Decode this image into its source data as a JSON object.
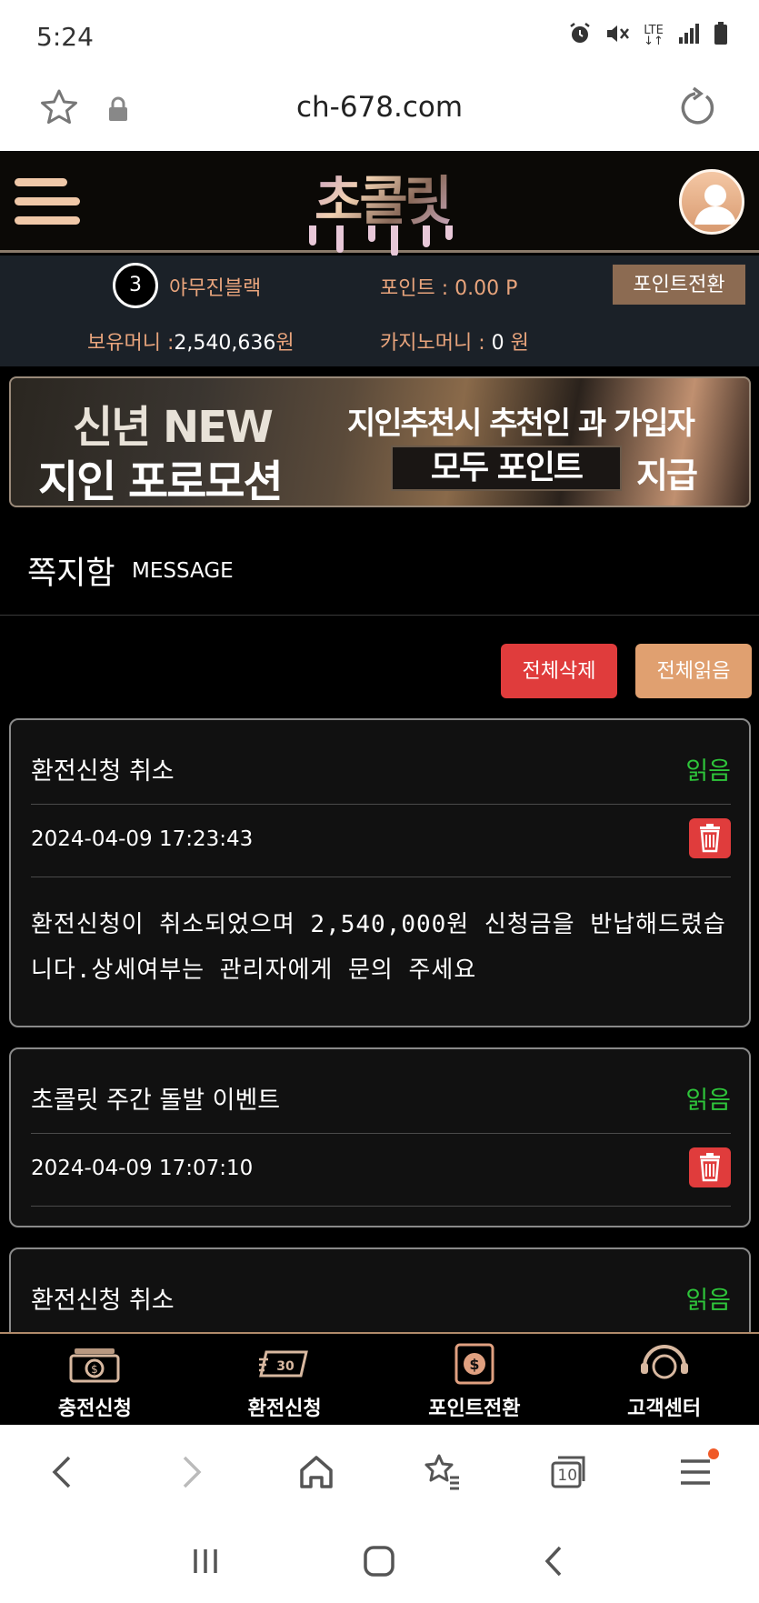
{
  "status_bar": {
    "time": "5:24",
    "icons": [
      "alarm-icon",
      "mute-icon",
      "lte-icon",
      "signal-icon",
      "battery-icon"
    ],
    "lte_label": "LTE"
  },
  "browser": {
    "url": "ch-678.com",
    "tab_count": "10"
  },
  "header": {
    "logo_text": "초콜릿"
  },
  "user": {
    "level": "3",
    "name": "야무진블랙",
    "points_label": "포인트 : ",
    "points_value": "0.00 P",
    "point_convert_label": "포인트전환",
    "money_label": "보유머니 :",
    "money_value": "2,540,636",
    "money_unit": "원",
    "casino_label": "카지노머니 : ",
    "casino_value": "0",
    "casino_unit": " 원"
  },
  "banner": {
    "line1": "신년 NEW",
    "line2": "지인 포로모션",
    "right1": "지인추천시 추천인 과 가입자",
    "right2": "모두 포인트",
    "right3": "지급"
  },
  "section": {
    "title": "쪽지함",
    "subtitle": "MESSAGE"
  },
  "actions": {
    "delete_all": "전체삭제",
    "read_all": "전체읽음"
  },
  "messages": [
    {
      "title": "환전신청 취소",
      "status": "읽음",
      "date": "2024-04-09 17:23:43",
      "body": "환전신청이 취소되었으며 2,540,000원 신청금을 반납해드렸습니다.상세여부는 관리자에게 문의 주세요"
    },
    {
      "title": "초콜릿 주간 돌발 이벤트",
      "status": "읽음",
      "date": "2024-04-09 17:07:10"
    },
    {
      "title": "환전신청 취소",
      "status": "읽음"
    }
  ],
  "bottom_nav": [
    {
      "label": "충전신청",
      "icon": "cash-stack-icon"
    },
    {
      "label": "환전신청",
      "icon": "cash-exchange-icon"
    },
    {
      "label": "포인트전환",
      "icon": "dollar-convert-icon"
    },
    {
      "label": "고객센터",
      "icon": "headset-icon"
    }
  ],
  "colors": {
    "accent": "#e8a47c",
    "read_status": "#2ec43a",
    "delete": "#e03c3c",
    "info_bar_bg": "#1b2128"
  }
}
